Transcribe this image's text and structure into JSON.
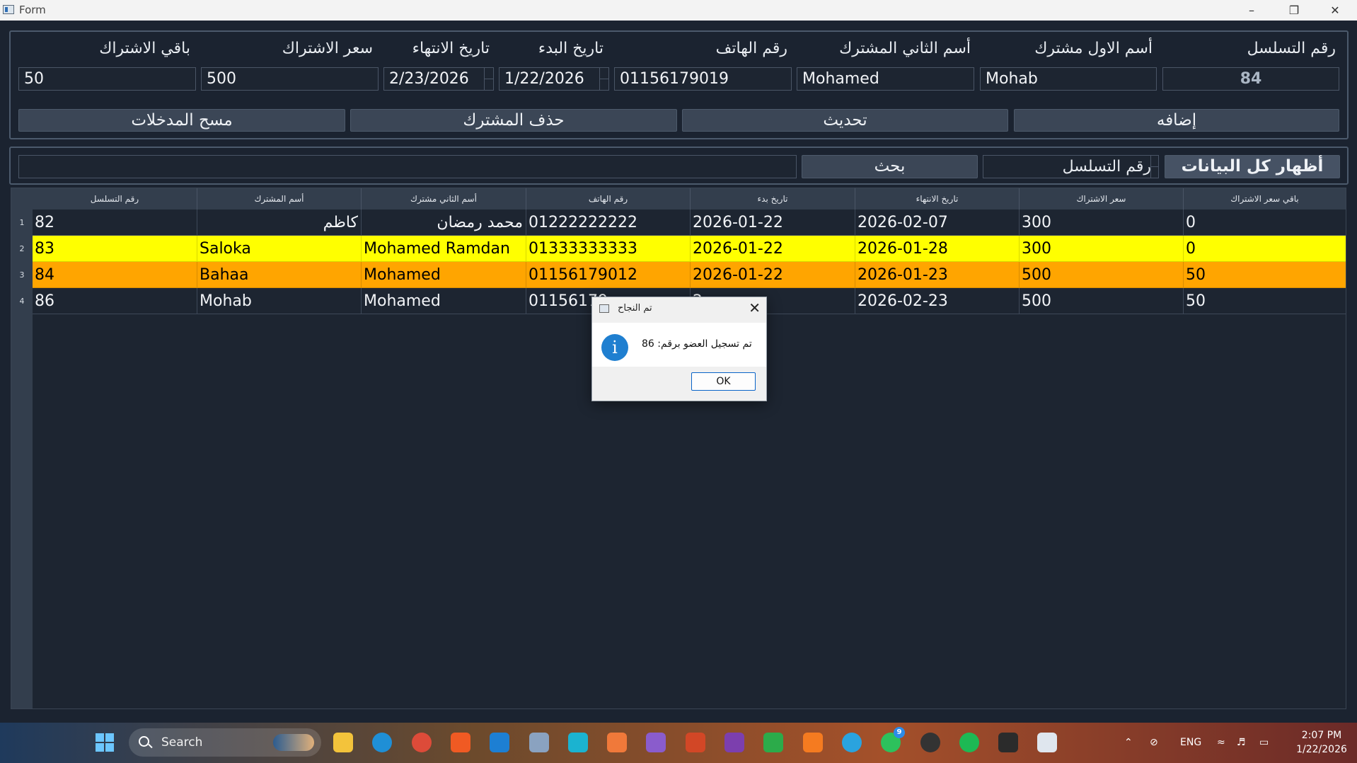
{
  "window": {
    "title": "Form"
  },
  "form": {
    "labels": {
      "serial": "رقم التسلسل",
      "first_name": "أسم الاول مشترك",
      "second_name": "أسم الثاني المشترك",
      "phone": "رقم الهاتف",
      "start_date": "تاريخ البدء",
      "end_date": "تاريخ الانتهاء",
      "price": "سعر الاشتراك",
      "remaining": "باقي الاشتراك"
    },
    "values": {
      "serial": "84",
      "first_name": "Mohab",
      "second_name": "Mohamed",
      "phone": "01156179019",
      "start_date": "1/22/2026",
      "end_date": "2/23/2026",
      "price": "500",
      "remaining": "50"
    },
    "buttons": {
      "add": "إضافه",
      "update": "تحديث",
      "delete": "حذف المشترك",
      "clear": "مسح المدخلات"
    }
  },
  "search": {
    "show_all": "أظهار كل البيانات",
    "field_label": "رقم التسلسل",
    "search_button": "بحث",
    "query": ""
  },
  "table": {
    "headers": [
      "رقم التسلسل",
      "أسم المشترك",
      "أسم الثاني مشترك",
      "رقم الهاتف",
      "تاريخ بدء",
      "تاريخ الانتهاء",
      "سعر الاشتراك",
      "باقي سعر الاشتراك"
    ],
    "rows": [
      {
        "num": "1",
        "cells": [
          "82",
          "كاظم",
          "محمد رمضان",
          "01222222222",
          "2026-01-22",
          "2026-02-07",
          "300",
          "0"
        ],
        "highlight": "none"
      },
      {
        "num": "2",
        "cells": [
          "83",
          "Saloka",
          "Mohamed Ramdan",
          "01333333333",
          "2026-01-22",
          "2026-01-28",
          "300",
          "0"
        ],
        "highlight": "#ffff00"
      },
      {
        "num": "3",
        "cells": [
          "84",
          "Bahaa",
          "Mohamed",
          "01156179012",
          "2026-01-22",
          "2026-01-23",
          "500",
          "50"
        ],
        "highlight": "#ffa500"
      },
      {
        "num": "4",
        "cells": [
          "86",
          "Mohab",
          "Mohamed",
          "01156179",
          "2",
          "2026-02-23",
          "500",
          "50"
        ],
        "highlight": "none"
      }
    ]
  },
  "dialog": {
    "title": "تم النجاح",
    "message": "تم تسجيل العضو برقم: 86",
    "ok": "OK",
    "icon": "info-icon"
  },
  "taskbar": {
    "search_placeholder": "Search",
    "whatsapp_badge": "9",
    "language": "ENG",
    "time": "2:07 PM",
    "date": "1/22/2026"
  },
  "colors": {
    "background": "#1b2330",
    "row_yellow": "#ffff00",
    "row_orange": "#ffa500",
    "accent": "#1f7fd0"
  }
}
